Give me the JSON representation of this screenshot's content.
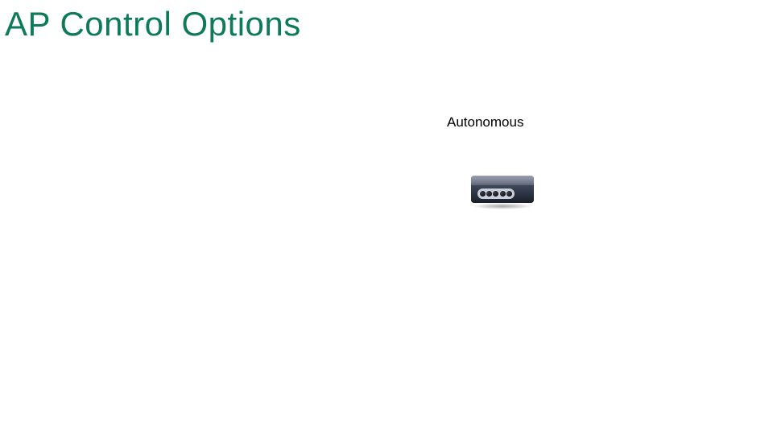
{
  "slide": {
    "title": "AP Control Options"
  },
  "labels": {
    "autonomous": "Autonomous"
  },
  "device": {
    "type": "access-point-hardware",
    "ports": 5
  }
}
